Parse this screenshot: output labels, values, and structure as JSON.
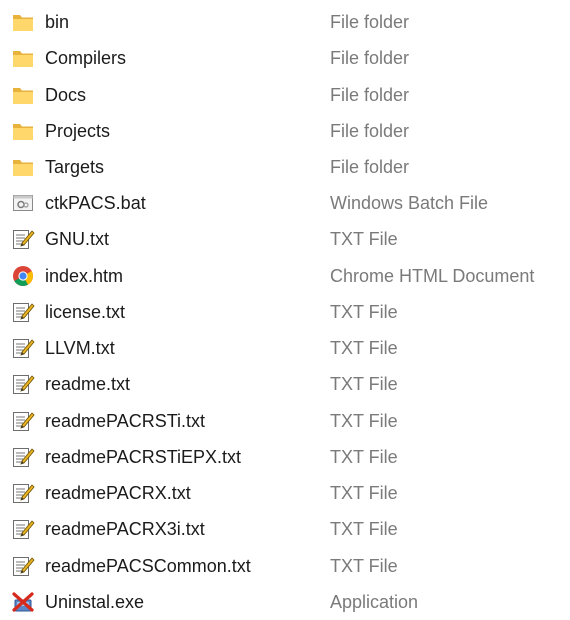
{
  "files": [
    {
      "name": "bin",
      "type": "File folder",
      "icon": "folder-icon"
    },
    {
      "name": "Compilers",
      "type": "File folder",
      "icon": "folder-icon"
    },
    {
      "name": "Docs",
      "type": "File folder",
      "icon": "folder-icon"
    },
    {
      "name": "Projects",
      "type": "File folder",
      "icon": "folder-icon"
    },
    {
      "name": "Targets",
      "type": "File folder",
      "icon": "folder-icon"
    },
    {
      "name": "ctkPACS.bat",
      "type": "Windows Batch File",
      "icon": "batch-file-icon"
    },
    {
      "name": "GNU.txt",
      "type": "TXT File",
      "icon": "text-file-icon"
    },
    {
      "name": "index.htm",
      "type": "Chrome HTML Document",
      "icon": "chrome-icon"
    },
    {
      "name": "license.txt",
      "type": "TXT File",
      "icon": "text-file-icon"
    },
    {
      "name": "LLVM.txt",
      "type": "TXT File",
      "icon": "text-file-icon"
    },
    {
      "name": "readme.txt",
      "type": "TXT File",
      "icon": "text-file-icon"
    },
    {
      "name": "readmePACRSTi.txt",
      "type": "TXT File",
      "icon": "text-file-icon"
    },
    {
      "name": "readmePACRSTiEPX.txt",
      "type": "TXT File",
      "icon": "text-file-icon"
    },
    {
      "name": "readmePACRX.txt",
      "type": "TXT File",
      "icon": "text-file-icon"
    },
    {
      "name": "readmePACRX3i.txt",
      "type": "TXT File",
      "icon": "text-file-icon"
    },
    {
      "name": "readmePACSCommon.txt",
      "type": "TXT File",
      "icon": "text-file-icon"
    },
    {
      "name": "Uninstal.exe",
      "type": "Application",
      "icon": "uninstaller-app-icon"
    }
  ],
  "colors": {
    "folder": "#ffd76b",
    "folder_dark": "#e8b33c",
    "name_text": "#1b1b1b",
    "type_text": "#7a7a7a",
    "hover": "#e5f3ff"
  }
}
